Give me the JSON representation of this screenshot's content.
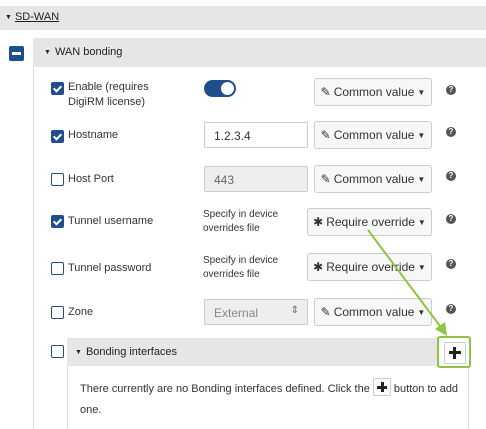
{
  "top_section": {
    "title": "SD-WAN"
  },
  "group": {
    "title": "WAN bonding"
  },
  "rows": [
    {
      "key": "enable",
      "label": "Enable (requires DigiRM license)",
      "checked": true,
      "control": "toggle",
      "toggle_on": true,
      "dropdown": {
        "icon": "edit-icon",
        "label": "Common value"
      }
    },
    {
      "key": "hostname",
      "label": "Hostname",
      "checked": true,
      "value": "1.2.3.4",
      "dropdown": {
        "icon": "edit-icon",
        "label": "Common value"
      }
    },
    {
      "key": "host_port",
      "label": "Host Port",
      "checked": false,
      "value": "443",
      "dropdown": {
        "icon": "edit-icon",
        "label": "Common value"
      }
    },
    {
      "key": "tunnel_username",
      "label": "Tunnel username",
      "checked": true,
      "note": "Specify in device overrides file",
      "dropdown": {
        "icon": "asterisk-icon",
        "label": "Require override"
      }
    },
    {
      "key": "tunnel_password",
      "label": "Tunnel password",
      "checked": false,
      "note": "Specify in device overrides file",
      "dropdown": {
        "icon": "asterisk-icon",
        "label": "Require override"
      }
    },
    {
      "key": "zone",
      "label": "Zone",
      "checked": false,
      "value": "External",
      "dropdown": {
        "icon": "edit-icon",
        "label": "Common value"
      }
    }
  ],
  "bonding": {
    "title": "Bonding interfaces",
    "empty_before": "There currently are no Bonding interfaces defined. Click the",
    "empty_after": "button to add one."
  },
  "colors": {
    "accent": "#1f4e8c",
    "highlight": "#8cc63f",
    "header_bg": "#e6e6e6"
  }
}
